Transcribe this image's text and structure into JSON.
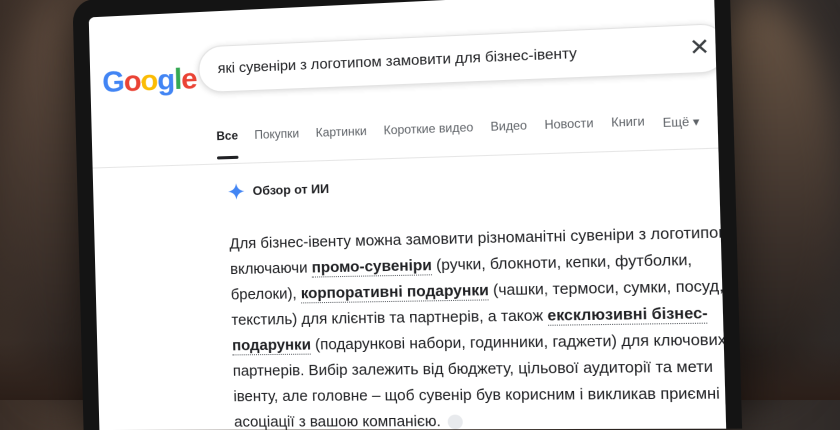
{
  "header": {
    "logo": "Google",
    "search_query": "які сувеніри з логотипом замовити для бізнес-івенту",
    "clear_label": "✕"
  },
  "tabs": [
    {
      "label": "Все"
    },
    {
      "label": "Покупки"
    },
    {
      "label": "Картинки"
    },
    {
      "label": "Короткие видео"
    },
    {
      "label": "Видео"
    },
    {
      "label": "Новости"
    },
    {
      "label": "Книги"
    },
    {
      "label": "Ещё ▾"
    }
  ],
  "ai_overview": {
    "title": "Обзор от ИИ",
    "p1": "Для бізнес-івенту можна замовити різноманітні сувеніри з логотипом, включаючи ",
    "b1": "промо-сувеніри",
    "p2": " (ручки, блокноти, кепки, футболки, брелоки), ",
    "b2": "корпоративні подарунки",
    "p3": " (чашки, термоси, сумки, посуд, текстиль) для клієнтів та партнерів, а також ",
    "b3": "ексклюзивні бізнес-подарунки",
    "p4": " (подарункові набори, годинники, гаджети) для ключових партнерів. Вибір залежить від бюджету, цільової аудиторії та мети івенту, але головне – щоб сувенір був корисним і викликав приємні асоціації з вашою компанією."
  },
  "colors": {
    "google_blue": "#4285F4",
    "google_red": "#EA4335",
    "google_yellow": "#FBBC05",
    "google_green": "#34A853"
  }
}
